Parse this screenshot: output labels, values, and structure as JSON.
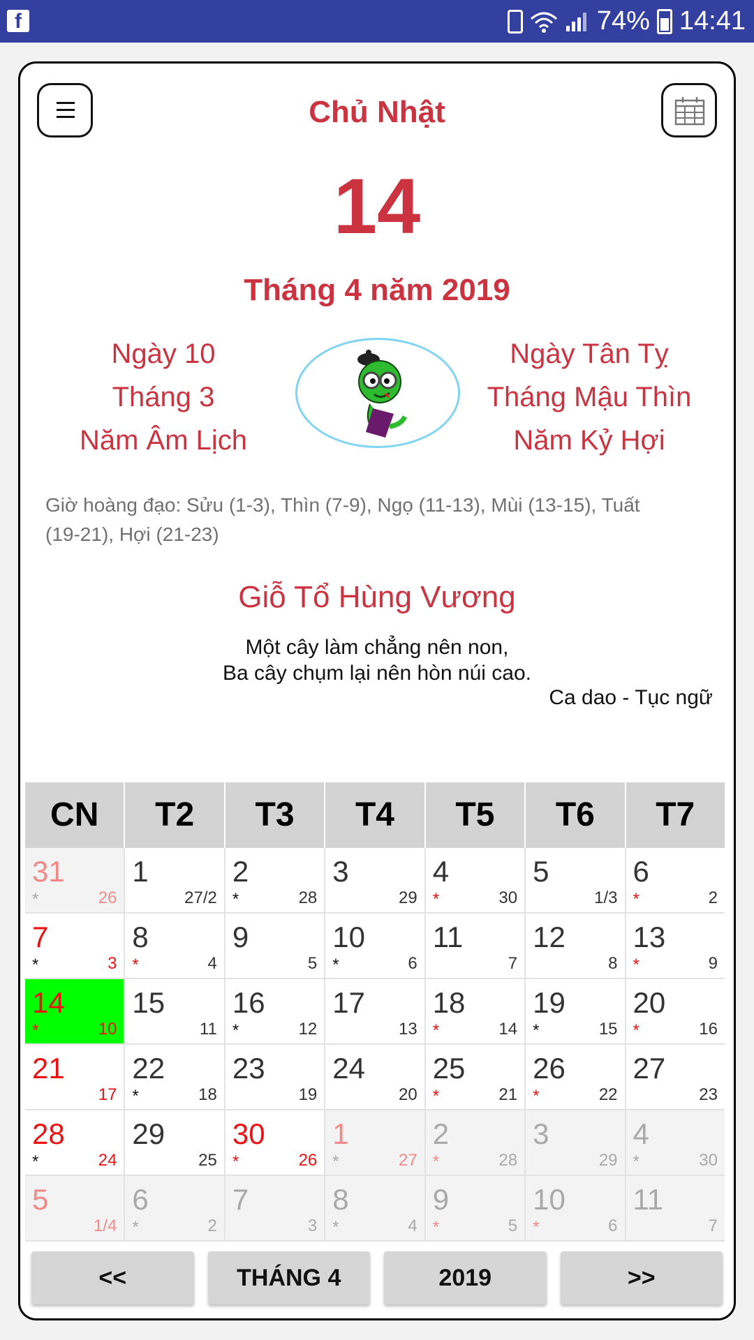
{
  "status_bar": {
    "app_icon": "facebook-icon",
    "battery": "74%",
    "time": "14:41"
  },
  "header": {
    "weekday": "Chủ Nhật",
    "day": "14",
    "month_year": "Tháng 4 năm 2019"
  },
  "lunar_left": [
    "Ngày 10",
    "Tháng 3",
    "Năm Âm Lịch"
  ],
  "lunar_right": [
    "Ngày Tân Tỵ",
    "Tháng Mậu Thìn",
    "Năm Kỷ Hợi"
  ],
  "lucky_hours": "Giờ hoàng đạo: Sửu (1-3), Thìn (7-9), Ngọ (11-13), Mùi (13-15), Tuất (19-21), Hợi (21-23)",
  "festival": "Giỗ Tổ Hùng Vương",
  "proverb": {
    "line1": "Một cây làm chẳng nên non,",
    "line2": "Ba cây chụm lại nên hòn núi cao.",
    "source": "Ca dao - Tục ngữ"
  },
  "calendar": {
    "headers": [
      "CN",
      "T2",
      "T3",
      "T4",
      "T5",
      "T6",
      "T7"
    ],
    "weeks": [
      [
        {
          "day": "31",
          "lunar": "26",
          "mark": "*",
          "style": "out-sun"
        },
        {
          "day": "1",
          "lunar": "27/2",
          "mark": "",
          "style": "normal"
        },
        {
          "day": "2",
          "lunar": "28",
          "mark": "*",
          "style": "normal"
        },
        {
          "day": "3",
          "lunar": "29",
          "mark": "",
          "style": "normal"
        },
        {
          "day": "4",
          "lunar": "30",
          "mark": "*r",
          "style": "normal"
        },
        {
          "day": "5",
          "lunar": "1/3",
          "mark": "",
          "style": "normal"
        },
        {
          "day": "6",
          "lunar": "2",
          "mark": "*r",
          "style": "normal"
        }
      ],
      [
        {
          "day": "7",
          "lunar": "3",
          "mark": "*",
          "style": "sun"
        },
        {
          "day": "8",
          "lunar": "4",
          "mark": "*r",
          "style": "normal"
        },
        {
          "day": "9",
          "lunar": "5",
          "mark": "",
          "style": "normal"
        },
        {
          "day": "10",
          "lunar": "6",
          "mark": "*",
          "style": "normal"
        },
        {
          "day": "11",
          "lunar": "7",
          "mark": "",
          "style": "normal"
        },
        {
          "day": "12",
          "lunar": "8",
          "mark": "",
          "style": "normal"
        },
        {
          "day": "13",
          "lunar": "9",
          "mark": "*r",
          "style": "normal"
        }
      ],
      [
        {
          "day": "14",
          "lunar": "10",
          "mark": "*r",
          "style": "today"
        },
        {
          "day": "15",
          "lunar": "11",
          "mark": "",
          "style": "normal"
        },
        {
          "day": "16",
          "lunar": "12",
          "mark": "*",
          "style": "normal"
        },
        {
          "day": "17",
          "lunar": "13",
          "mark": "",
          "style": "normal"
        },
        {
          "day": "18",
          "lunar": "14",
          "mark": "*r",
          "style": "normal"
        },
        {
          "day": "19",
          "lunar": "15",
          "mark": "*",
          "style": "normal"
        },
        {
          "day": "20",
          "lunar": "16",
          "mark": "*r",
          "style": "normal"
        }
      ],
      [
        {
          "day": "21",
          "lunar": "17",
          "mark": "",
          "style": "sun"
        },
        {
          "day": "22",
          "lunar": "18",
          "mark": "*",
          "style": "normal"
        },
        {
          "day": "23",
          "lunar": "19",
          "mark": "",
          "style": "normal"
        },
        {
          "day": "24",
          "lunar": "20",
          "mark": "",
          "style": "normal"
        },
        {
          "day": "25",
          "lunar": "21",
          "mark": "*r",
          "style": "normal"
        },
        {
          "day": "26",
          "lunar": "22",
          "mark": "*r",
          "style": "normal"
        },
        {
          "day": "27",
          "lunar": "23",
          "mark": "",
          "style": "normal"
        }
      ],
      [
        {
          "day": "28",
          "lunar": "24",
          "mark": "*",
          "style": "sun"
        },
        {
          "day": "29",
          "lunar": "25",
          "mark": "",
          "style": "normal"
        },
        {
          "day": "30",
          "lunar": "26",
          "mark": "*r",
          "style": "holiday"
        },
        {
          "day": "1",
          "lunar": "27",
          "mark": "*",
          "style": "out-holiday"
        },
        {
          "day": "2",
          "lunar": "28",
          "mark": "*p",
          "style": "out"
        },
        {
          "day": "3",
          "lunar": "29",
          "mark": "",
          "style": "out"
        },
        {
          "day": "4",
          "lunar": "30",
          "mark": "*",
          "style": "out"
        }
      ],
      [
        {
          "day": "5",
          "lunar": "1/4",
          "mark": "",
          "style": "out-sun"
        },
        {
          "day": "6",
          "lunar": "2",
          "mark": "*",
          "style": "out"
        },
        {
          "day": "7",
          "lunar": "3",
          "mark": "",
          "style": "out"
        },
        {
          "day": "8",
          "lunar": "4",
          "mark": "*",
          "style": "out"
        },
        {
          "day": "9",
          "lunar": "5",
          "mark": "*p",
          "style": "out"
        },
        {
          "day": "10",
          "lunar": "6",
          "mark": "*p",
          "style": "out"
        },
        {
          "day": "11",
          "lunar": "7",
          "mark": "",
          "style": "out"
        }
      ]
    ]
  },
  "nav": {
    "prev": "<<",
    "month": "THÁNG 4",
    "year": "2019",
    "next": ">>"
  },
  "colors": {
    "accent_red": "#cc3340",
    "today_green": "#00ff00",
    "status_bar": "#3340a0"
  }
}
